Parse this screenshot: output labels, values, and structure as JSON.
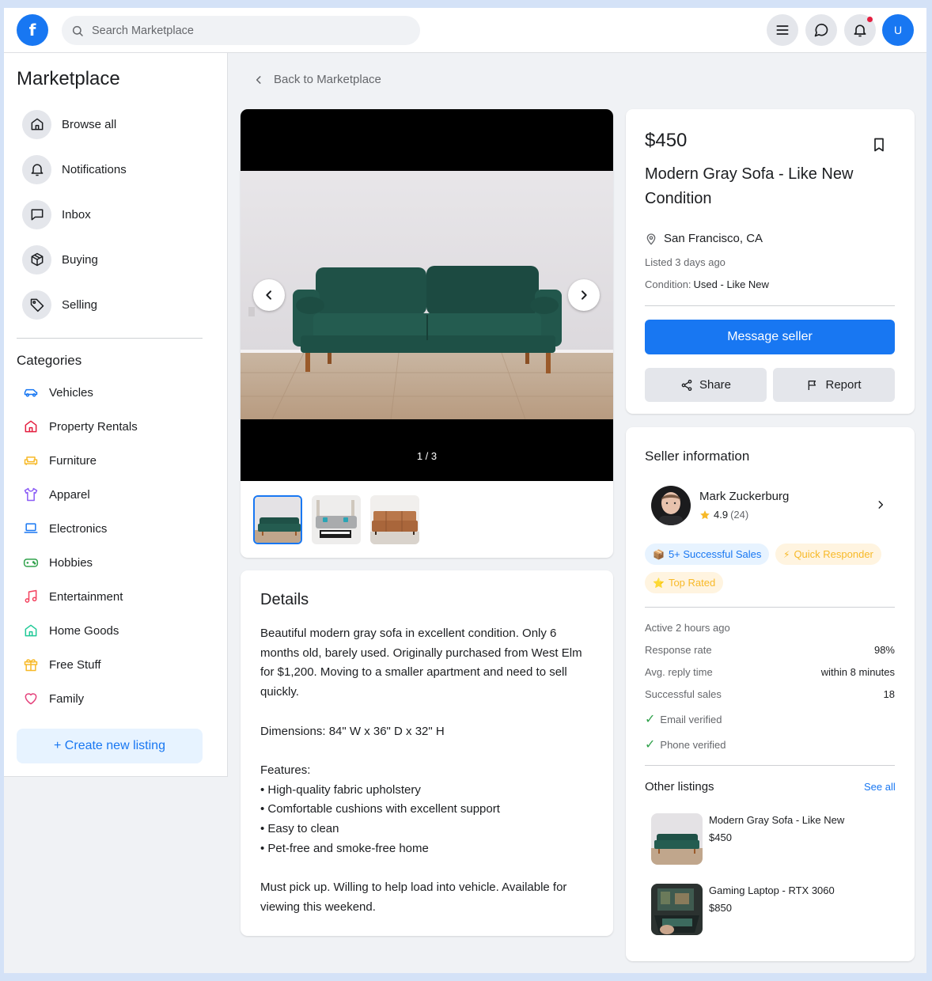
{
  "header": {
    "logo": "f",
    "search_placeholder": "Search Marketplace",
    "user_initial": "U"
  },
  "sidebar": {
    "title": "Marketplace",
    "nav": [
      {
        "label": "Browse all",
        "icon": "home-icon"
      },
      {
        "label": "Notifications",
        "icon": "bell-icon"
      },
      {
        "label": "Inbox",
        "icon": "message-icon"
      },
      {
        "label": "Buying",
        "icon": "box-icon"
      },
      {
        "label": "Selling",
        "icon": "tag-icon"
      }
    ],
    "categories_title": "Categories",
    "categories": [
      {
        "label": "Vehicles",
        "icon": "car-icon",
        "color": "#1877f2"
      },
      {
        "label": "Property Rentals",
        "icon": "house-icon",
        "color": "#e41e3f"
      },
      {
        "label": "Furniture",
        "icon": "sofa-icon",
        "color": "#f7b928"
      },
      {
        "label": "Apparel",
        "icon": "shirt-icon",
        "color": "#8b5cf6"
      },
      {
        "label": "Electronics",
        "icon": "laptop-icon",
        "color": "#1877f2"
      },
      {
        "label": "Hobbies",
        "icon": "gamepad-icon",
        "color": "#31a24c"
      },
      {
        "label": "Entertainment",
        "icon": "music-icon",
        "color": "#f3425f"
      },
      {
        "label": "Home Goods",
        "icon": "home-goods-icon",
        "color": "#20c997"
      },
      {
        "label": "Free Stuff",
        "icon": "gift-icon",
        "color": "#f7b928"
      },
      {
        "label": "Family",
        "icon": "heart-icon",
        "color": "#e4407a"
      }
    ],
    "create_label": "+ Create new listing"
  },
  "main": {
    "back_label": "Back to Marketplace",
    "gallery": {
      "counter": "1 / 3"
    },
    "details": {
      "title": "Details",
      "description": "Beautiful modern gray sofa in excellent condition. Only 6 months old, barely used. Originally purchased from West Elm for $1,200. Moving to a smaller apartment and need to sell quickly.\n\nDimensions: 84\" W x 36\" D x 32\" H\n\nFeatures:\n• High-quality fabric upholstery\n• Comfortable cushions with excellent support\n• Easy to clean\n• Pet-free and smoke-free home\n\nMust pick up. Willing to help load into vehicle. Available for viewing this weekend."
    }
  },
  "listing": {
    "price": "$450",
    "title": "Modern Gray Sofa - Like New Condition",
    "location": "San Francisco, CA",
    "listed": "Listed 3 days ago",
    "condition_label": "Condition:",
    "condition_value": "Used - Like New",
    "message_label": "Message seller",
    "share_label": "Share",
    "report_label": "Report"
  },
  "seller": {
    "section_title": "Seller information",
    "name": "Mark Zuckerburg",
    "rating": "4.9",
    "rating_count": "(24)",
    "badges": {
      "sales": "5+ Successful Sales",
      "quick": "Quick Responder",
      "top": "Top Rated"
    },
    "active": "Active 2 hours ago",
    "stats": [
      {
        "label": "Response rate",
        "value": "98%"
      },
      {
        "label": "Avg. reply time",
        "value": "within 8 minutes"
      },
      {
        "label": "Successful sales",
        "value": "18"
      }
    ],
    "email_verified": "Email verified",
    "phone_verified": "Phone verified",
    "other_title": "Other listings",
    "see_all": "See all",
    "other_listings": [
      {
        "title": "Modern Gray Sofa - Like New",
        "price": "$450"
      },
      {
        "title": "Gaming Laptop - RTX 3060",
        "price": "$850"
      }
    ]
  },
  "colors": {
    "brand": "#1877f2",
    "background": "#f0f2f5"
  }
}
